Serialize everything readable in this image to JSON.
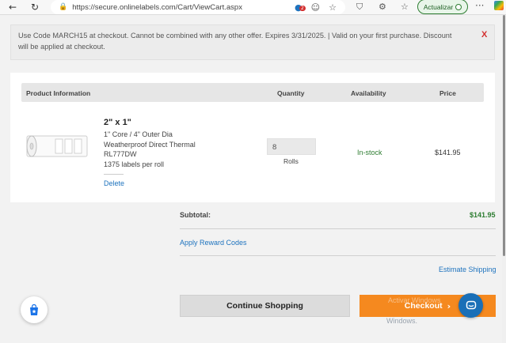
{
  "browser": {
    "url": "https://secure.onlinelabels.com/Cart/ViewCart.aspx",
    "update_label": "Actualizar",
    "ext_badge": "2"
  },
  "promo": {
    "text": "Use Code MARCH15 at checkout. Cannot be combined with any other offer. Expires 3/31/2025. | Valid on your first purchase. Discount will be applied at checkout.",
    "close": "X"
  },
  "table": {
    "headers": {
      "product": "Product Information",
      "quantity": "Quantity",
      "availability": "Availability",
      "price": "Price"
    }
  },
  "item": {
    "title": "2\" x 1\"",
    "desc_lines": [
      "1\" Core / 4\" Outer Dia",
      "Weatherproof Direct Thermal",
      "RL777DW",
      "1375 labels per roll"
    ],
    "delete": "Delete",
    "quantity": "8",
    "unit": "Rolls",
    "availability": "In-stock",
    "price": "$141.95"
  },
  "summary": {
    "subtotal_label": "Subtotal:",
    "subtotal_value": "$141.95",
    "reward_link": "Apply Reward Codes",
    "shipping_link": "Estimate Shipping",
    "continue_label": "Continue Shopping",
    "checkout_label": "Checkout"
  },
  "watermark": {
    "line1": "Activar Windows",
    "line2": "Windows."
  },
  "colors": {
    "accent_orange": "#f5891f",
    "link_blue": "#1e73be",
    "stock_green": "#2e7d32"
  }
}
